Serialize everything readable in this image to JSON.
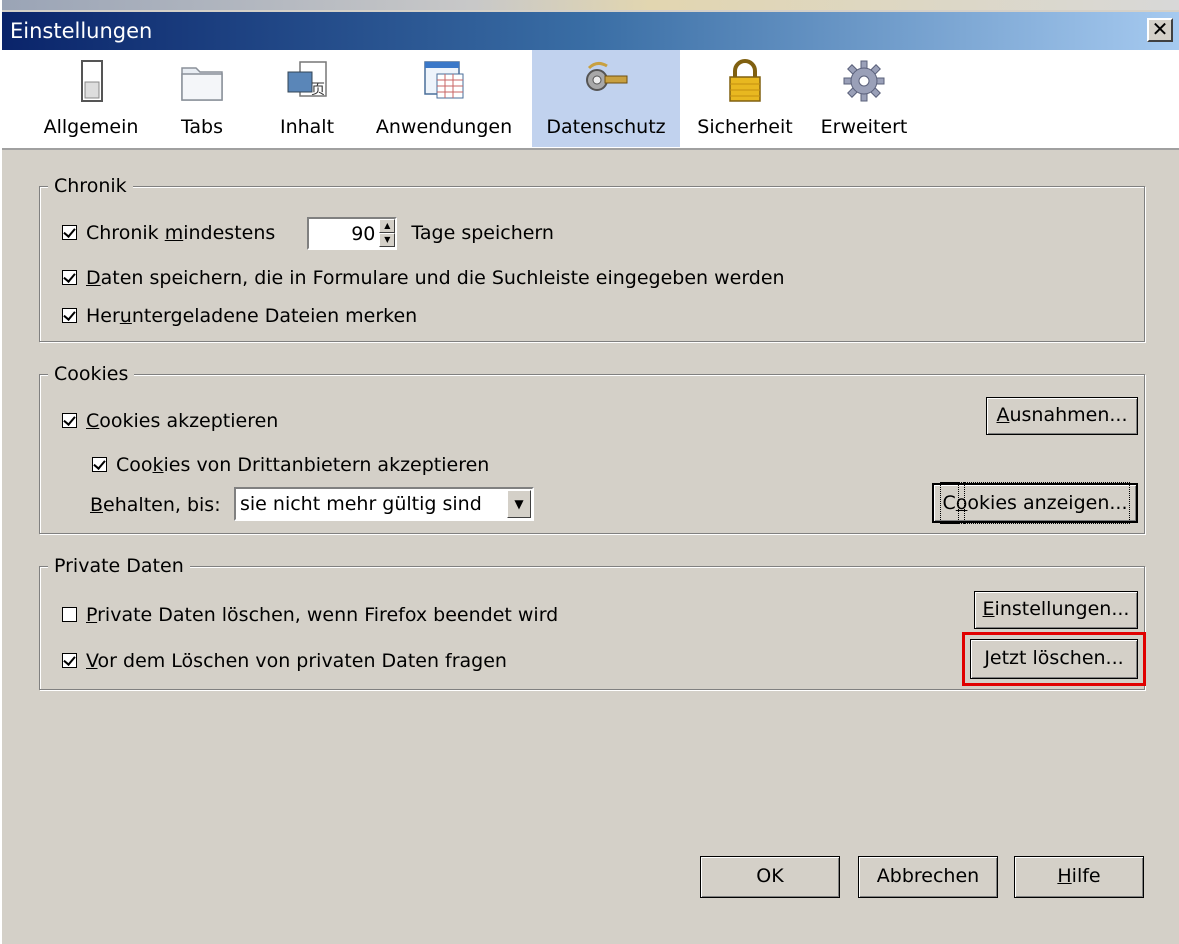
{
  "window": {
    "title": "Einstellungen",
    "close_glyph": "✕"
  },
  "toolbar": {
    "items": [
      {
        "label": "Allgemein",
        "icon": "switch-icon"
      },
      {
        "label": "Tabs",
        "icon": "folder-tabs-icon"
      },
      {
        "label": "Inhalt",
        "icon": "content-page-icon"
      },
      {
        "label": "Anwendungen",
        "icon": "applications-window-icon"
      },
      {
        "label": "Datenschutz",
        "icon": "privacy-key-icon",
        "selected": true
      },
      {
        "label": "Sicherheit",
        "icon": "padlock-icon"
      },
      {
        "label": "Erweitert",
        "icon": "gear-icon"
      }
    ]
  },
  "history": {
    "legend": "Chronik",
    "keep_prefix": "Chronik ",
    "keep_underline": "m",
    "keep_rest": "indestens",
    "days_value": "90",
    "keep_suffix": "Tage speichern",
    "forms_underline": "D",
    "forms_rest": "aten speichern, die in Formulare und die Suchleiste eingegeben werden",
    "downloads_prefix": "Her",
    "downloads_underline": "u",
    "downloads_rest": "ntergeladene Dateien merken"
  },
  "cookies": {
    "legend": "Cookies",
    "accept_underline": "C",
    "accept_rest": "ookies akzeptieren",
    "third_prefix": "Coo",
    "third_underline": "k",
    "third_rest": "ies von Drittanbietern akzeptieren",
    "keep_underline": "B",
    "keep_rest": "ehalten, bis:",
    "keep_value": "sie nicht mehr gültig sind",
    "exceptions_underline": "A",
    "exceptions_rest": "usnahmen...",
    "show_prefix": "C",
    "show_underline": "o",
    "show_rest": "okies anzeigen..."
  },
  "private": {
    "legend": "Private Daten",
    "clear_on_exit_underline": "P",
    "clear_on_exit_rest": "rivate Daten löschen, wenn Firefox beendet wird",
    "ask_underline": "V",
    "ask_rest": "or dem Löschen von privaten Daten fragen",
    "settings_underline": "E",
    "settings_rest": "instellungen...",
    "clear_now_underline": "J",
    "clear_now_rest": "etzt löschen..."
  },
  "footer": {
    "ok": "OK",
    "cancel": "Abbrechen",
    "help_underline": "H",
    "help_rest": "ilfe"
  },
  "colors": {
    "highlight": "#e00000",
    "selected_tab": "#c1d2ee",
    "titlebar_start": "#0a246a"
  }
}
